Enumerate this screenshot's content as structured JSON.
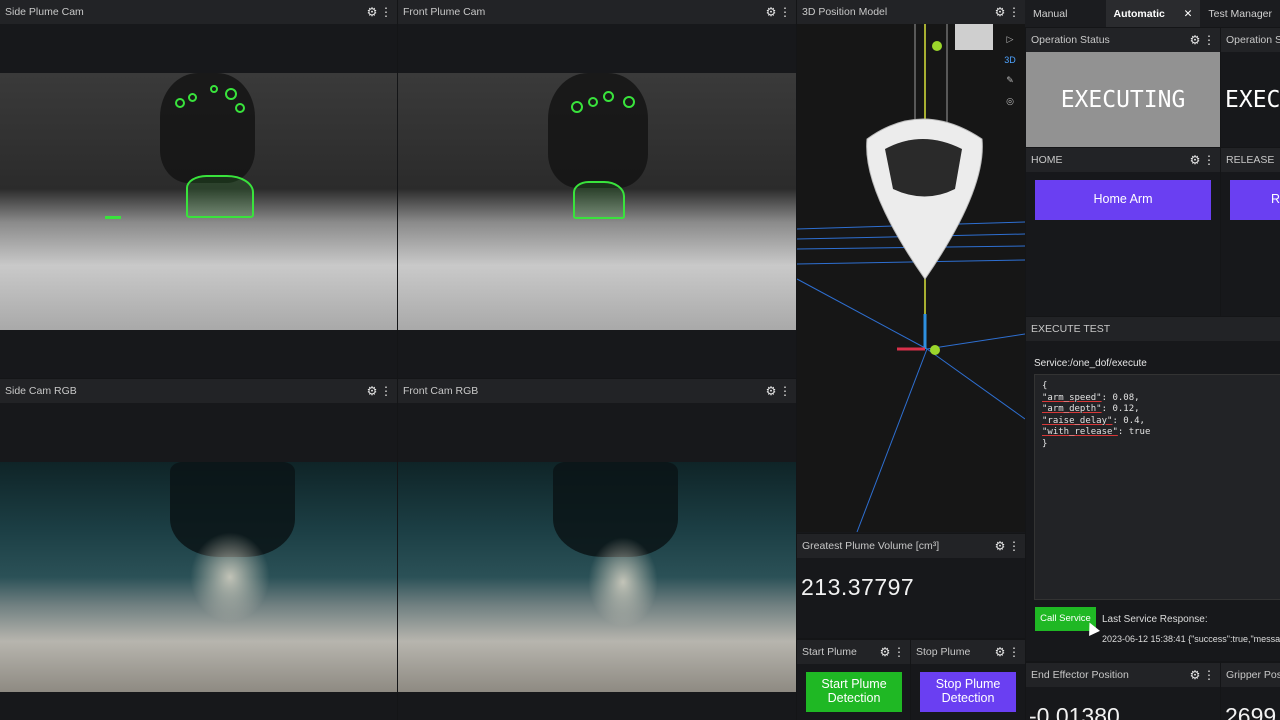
{
  "panels": {
    "side_plume_cam": "Side Plume Cam",
    "front_plume_cam": "Front Plume Cam",
    "side_cam_rgb": "Side Cam RGB",
    "front_cam_rgb": "Front Cam RGB",
    "position_model": "3D Position Model",
    "greatest_plume_volume": "Greatest Plume Volume [cm³]",
    "start_plume": "Start Plume",
    "stop_plume": "Stop Plume",
    "operation_status": "Operation Status",
    "operation_status_2": "Operation Stat",
    "home": "HOME",
    "release": "RELEASE",
    "execute_test": "EXECUTE TEST",
    "end_effector_position": "End Effector Position",
    "gripper_position": "Gripper Positi"
  },
  "icons": {
    "gear": "⚙",
    "dots": "⋮",
    "close": "✕",
    "cursor": "▷",
    "view_3d": "3D",
    "ruler": "✎",
    "target": "◎"
  },
  "tabs": [
    {
      "label": "Manual"
    },
    {
      "label": "Automatic"
    },
    {
      "label": "Test Manager"
    }
  ],
  "status": {
    "value": "EXECUTING",
    "value_2": "EXEC"
  },
  "buttons": {
    "home_arm": "Home Arm",
    "release_arm": "R",
    "start_plume_detection": "Start Plume Detection",
    "stop_plume_detection": "Stop Plume Detection",
    "call_service": "Call Service"
  },
  "plume_volume": "213.37797",
  "service": {
    "label": "Service:",
    "name": "/one_dof/execute",
    "last_response_label": "Last Service Response:",
    "last_response": "2023-06-12 15:38:41 {\"success\":true,\"messa"
  },
  "request": {
    "open": "{",
    "lines": [
      {
        "key": "\"arm_speed\"",
        "value": ": 0.08,"
      },
      {
        "key": "\"arm_depth\"",
        "value": ": 0.12,"
      },
      {
        "key": "\"raise_delay\"",
        "value": ": 0.4,"
      },
      {
        "key": "\"with_release\"",
        "value": ": true"
      }
    ],
    "close": "}"
  },
  "end_effector": {
    "value": "-0.01380",
    "gripper": "2699"
  },
  "colors": {
    "accent_purple": "#6a3ff2",
    "accent_green": "#1fb824",
    "detect_green": "#39e33c"
  }
}
